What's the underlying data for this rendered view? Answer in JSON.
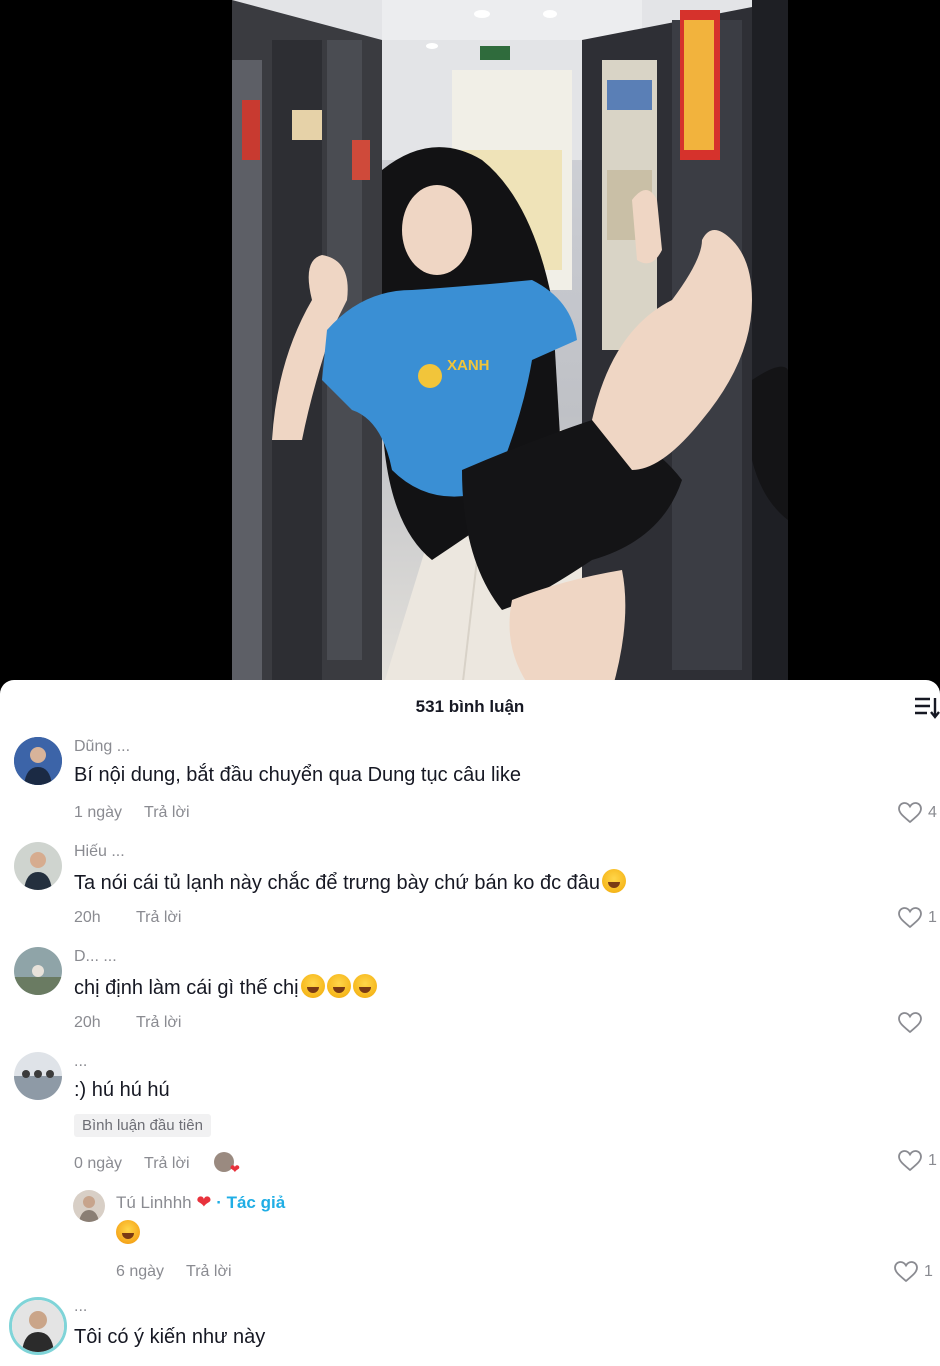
{
  "sheet": {
    "title": "531 bình luận",
    "sort_icon": "sort-list-icon"
  },
  "comments": [
    {
      "username": "Dũng ...",
      "text": "Bí nội dung, bắt đầu chuyển qua Dung tục câu like",
      "time": "1 ngày",
      "reply_label": "Trả lời",
      "likes": "4"
    },
    {
      "username": "Hiếu ...",
      "text": "Ta nói cái tủ lạnh này chắc để trưng bày chứ bán ko đc đâu",
      "time": "20h",
      "reply_label": "Trả lời",
      "likes": "1"
    },
    {
      "username": "D... ...",
      "text": "chị định làm cái gì thế chị",
      "time": "20h",
      "reply_label": "Trả lời",
      "likes": ""
    },
    {
      "username": "...",
      "text": ":) hú hú hú",
      "badge": "Bình luận đầu tiên",
      "time": "0 ngày",
      "reply_label": "Trả lời",
      "likes": "1"
    },
    {
      "username": "Tú Linhhh",
      "author_tag": "· Tác giả",
      "text": "",
      "time": "6 ngày",
      "reply_label": "Trả lời",
      "likes": "1"
    },
    {
      "username": "...",
      "text": "Tôi có ý kiến như này"
    }
  ],
  "colors": {
    "accent": "#20aee5",
    "text": "#161823",
    "muted": "#8a8b91",
    "heart": "#e8323c"
  }
}
